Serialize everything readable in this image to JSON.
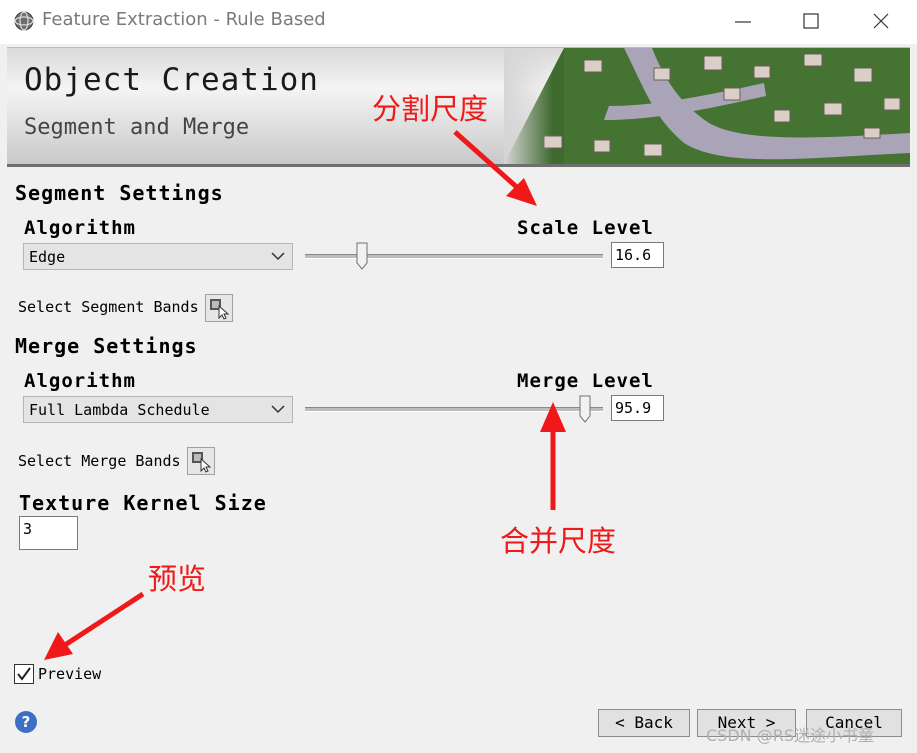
{
  "window": {
    "title": "Feature Extraction - Rule Based"
  },
  "banner": {
    "title": "Object Creation",
    "subtitle": "Segment and Merge"
  },
  "segment": {
    "section_title": "Segment Settings",
    "algorithm_label": "Algorithm",
    "algorithm_value": "Edge",
    "scale_label": "Scale Level",
    "scale_value": "16.6",
    "scale_fraction": 0.18,
    "bands_label": "Select Segment Bands"
  },
  "merge": {
    "section_title": "Merge Settings",
    "algorithm_label": "Algorithm",
    "algorithm_value": "Full Lambda Schedule",
    "level_label": "Merge Level",
    "level_value": "95.9",
    "level_fraction": 0.959,
    "bands_label": "Select Merge Bands"
  },
  "texture": {
    "label": "Texture Kernel Size",
    "value": "3"
  },
  "preview": {
    "label": "Preview",
    "checked": true
  },
  "buttons": {
    "back": "< Back",
    "next": "Next >",
    "cancel": "Cancel"
  },
  "annotations": {
    "scale": "分割尺度",
    "merge": "合并尺度",
    "preview": "预览"
  },
  "colors": {
    "annotation": "#f01818"
  },
  "watermark": "CSDN @RS迷途小书童"
}
